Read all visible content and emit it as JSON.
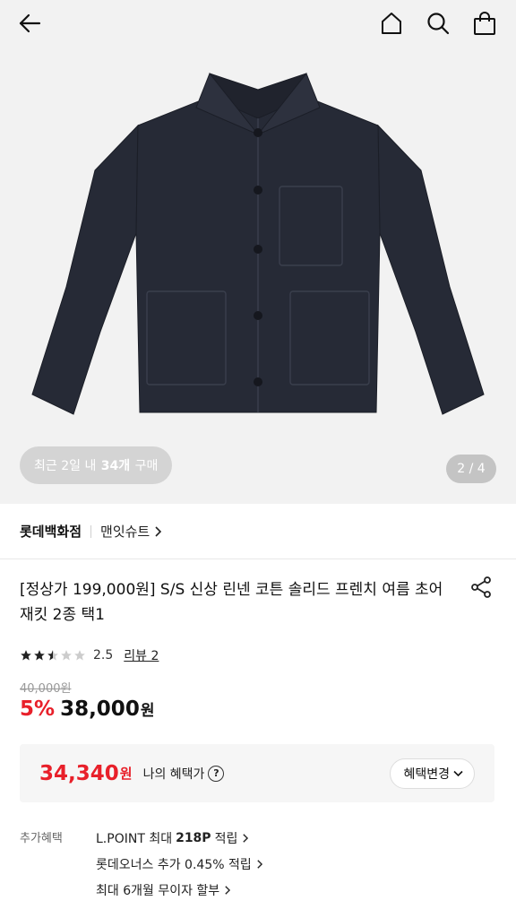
{
  "gallery": {
    "purchase_prefix": "최근 2일 내",
    "purchase_count": "34개",
    "purchase_suffix": "구매",
    "page_indicator": "2 / 4"
  },
  "brand": {
    "name": "롯데백화점",
    "sub": "맨잇슈트"
  },
  "product": {
    "title": "[정상가 199,000원] S/S 신상 린넨 코튼 솔리드 프렌치 여름 초어 재킷 2종 택1",
    "rating": 2.5,
    "rating_text": "2.5",
    "review_link": "리뷰 2",
    "original_price": "40,000원",
    "discount": "5%",
    "price": "38,000",
    "price_unit": "원"
  },
  "benefit": {
    "price": "34,340",
    "unit": "원",
    "label": "나의 혜택가",
    "change_button": "혜택변경"
  },
  "extra_benefits": {
    "label": "추가혜택",
    "lpoint_prefix": "L.POINT 최대",
    "lpoint_amount": "218P",
    "lpoint_suffix": "적립",
    "item2": "롯데오너스 추가 0.45% 적립",
    "item3": "최대 6개월 무이자 할부"
  },
  "colors": {
    "accent_red": "#e8202a",
    "jacket": "#262a36"
  },
  "icons": [
    "back-arrow-icon",
    "home-icon",
    "search-icon",
    "shopping-bag-icon",
    "share-icon",
    "star-icon",
    "question-icon",
    "chevron-right-icon",
    "chevron-down-icon"
  ]
}
